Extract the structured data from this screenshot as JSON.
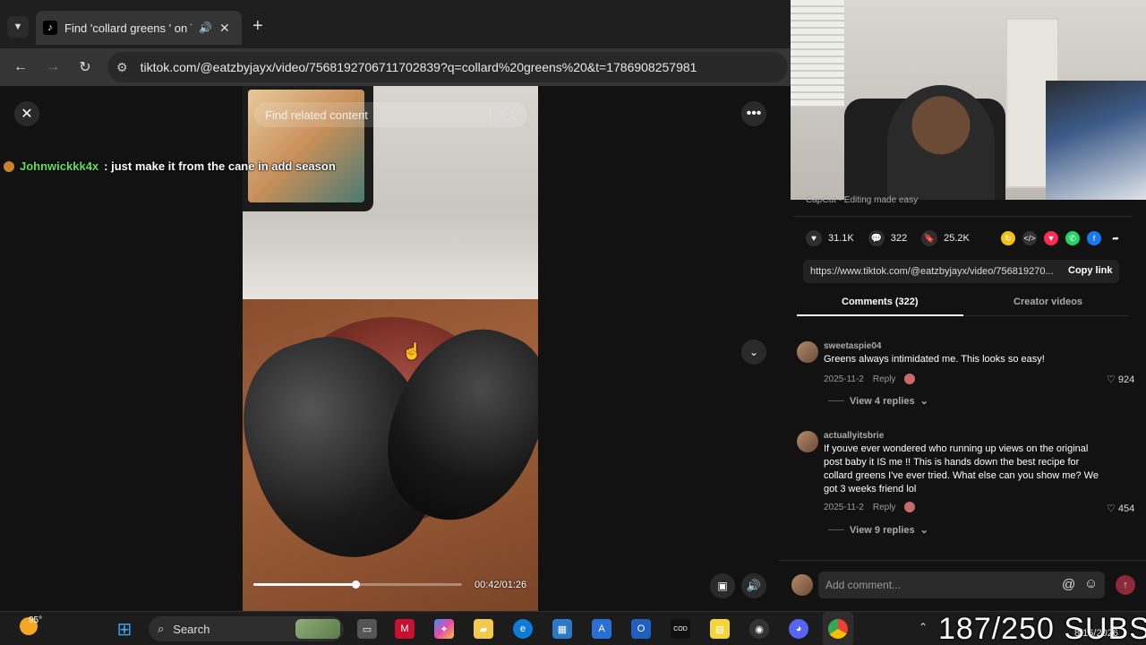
{
  "browser": {
    "tab": {
      "title": "Find 'collard greens ' on TikTok",
      "favicon": "tiktok-icon",
      "audio": "speaker-icon",
      "close": "✕"
    },
    "new_tab": "+",
    "url": "tiktok.com/@eatzbyjayx/video/7568192706711702839?q=collard%20greens%20&t=1786908257981"
  },
  "viewer": {
    "search_placeholder": "Find related content",
    "chat": {
      "user": "Johnwickkk4x",
      "message": ": just make it from the cane in add season"
    },
    "progress": {
      "fraction": 0.49,
      "timecode": "00:42/01:26"
    }
  },
  "panel": {
    "capcut": "CapCut · Editing made easy",
    "stats": {
      "likes": "31.1K",
      "comments": "322",
      "saves": "25.2K"
    },
    "link": {
      "url": "https://www.tiktok.com/@eatzbyjayx/video/756819270...",
      "copy_label": "Copy link"
    },
    "tabs": {
      "comments": "Comments (322)",
      "creator_videos": "Creator videos"
    },
    "comments": [
      {
        "user": "sweetaspie04",
        "text": "Greens always intimidated me. This looks so easy!",
        "date": "2025-11-2",
        "reply": "Reply",
        "likes": "924",
        "view_replies": "View 4 replies"
      },
      {
        "user": "actuallyitsbrie",
        "text": "If youve ever wondered who running up views on the original post baby it IS me !! This is hands down the best recipe for collard greens I've ever tried. What else can you show me? We got 3 weeks friend lol",
        "date": "2025-11-2",
        "reply": "Reply",
        "likes": "454",
        "view_replies": "View 9 replies"
      }
    ],
    "add_comment_placeholder": "Add comment..."
  },
  "taskbar": {
    "temperature": "95°",
    "search_label": "Search",
    "overlay_subs": "187/250 SUBS",
    "date": "8/16/2026"
  }
}
